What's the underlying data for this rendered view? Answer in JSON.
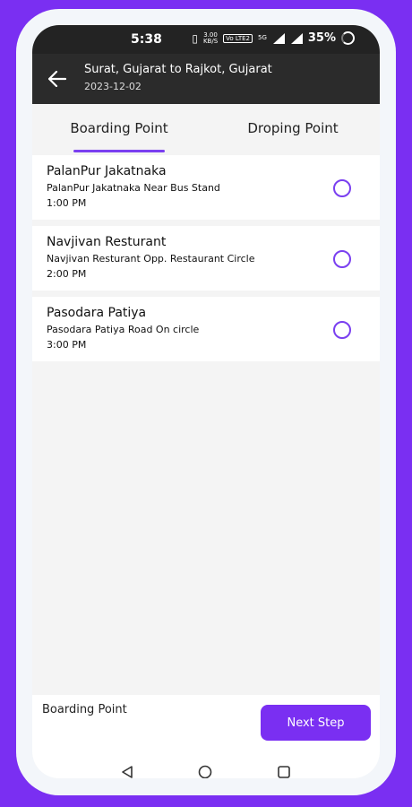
{
  "status_bar": {
    "time": "5:38",
    "speed": "3.00",
    "speed_unit": "KB/S",
    "network": "Vo LTE2",
    "signal_label": "5G",
    "battery_percent": "35%"
  },
  "header": {
    "route": "Surat, Gujarat  to  Rajkot, Gujarat",
    "date": "2023-12-02",
    "back_icon": "arrow-left-icon"
  },
  "tabs": [
    {
      "label": "Boarding Point",
      "active": true
    },
    {
      "label": "Droping Point",
      "active": false
    }
  ],
  "boarding_points": [
    {
      "name": "PalanPur Jakatnaka",
      "address": "PalanPur Jakatnaka Near Bus Stand",
      "time": "1:00 PM"
    },
    {
      "name": "Navjivan Resturant",
      "address": "Navjivan Resturant  Opp. Restaurant Circle",
      "time": "2:00 PM"
    },
    {
      "name": "Pasodara Patiya",
      "address": "Pasodara Patiya Road On circle",
      "time": "3:00 PM"
    }
  ],
  "footer": {
    "selection_label": "Boarding Point",
    "next_button": "Next Step"
  },
  "colors": {
    "accent": "#7a2ff2",
    "appbar": "#2b2b2b"
  }
}
